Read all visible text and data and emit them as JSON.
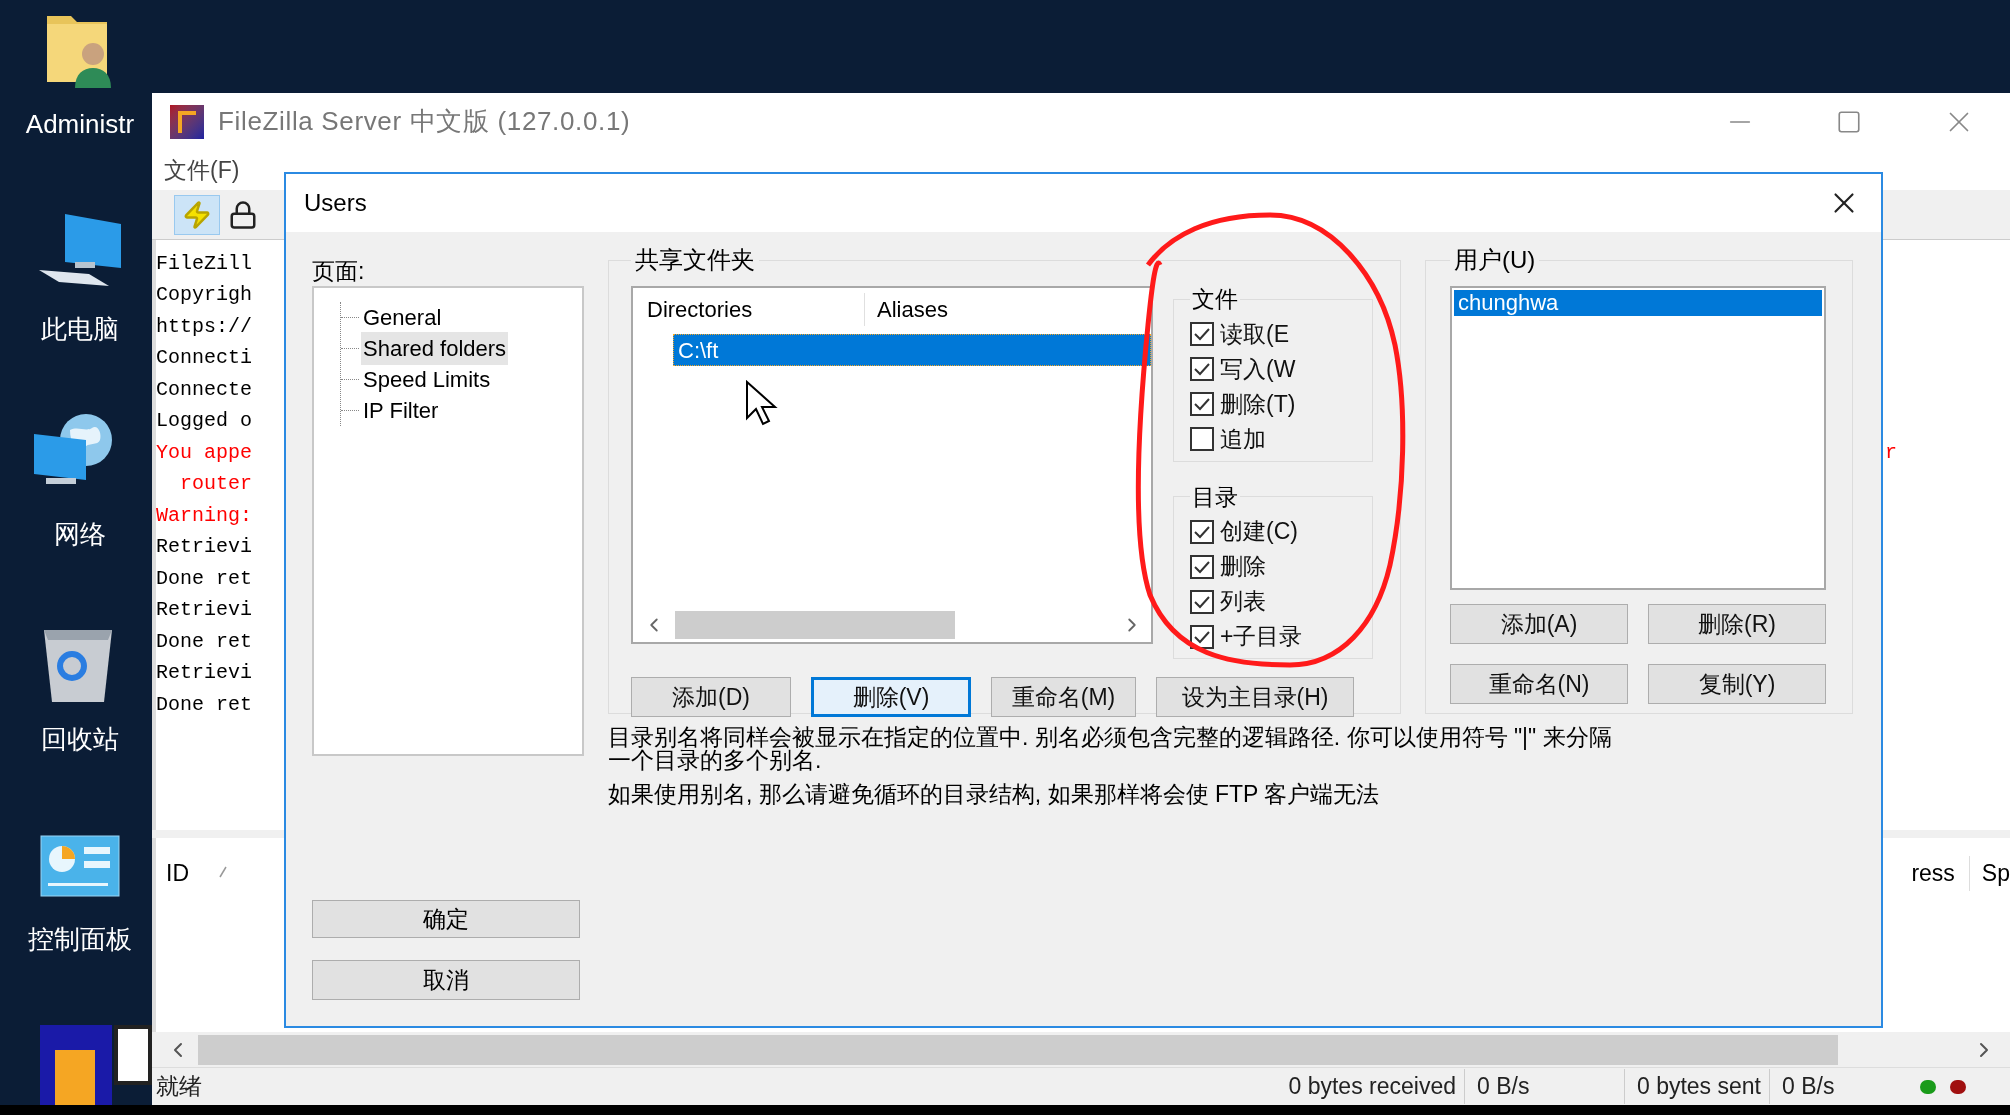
{
  "desktop": {
    "icons": [
      {
        "label": "Administr",
        "kind": "user-folder"
      },
      {
        "label": "此电脑",
        "kind": "computer"
      },
      {
        "label": "网络",
        "kind": "network"
      },
      {
        "label": "回收站",
        "kind": "recycle"
      },
      {
        "label": "控制面板",
        "kind": "control"
      }
    ]
  },
  "window": {
    "title": "FileZilla Server 中文版 (127.0.0.1)",
    "menu": [
      "文件(F)"
    ],
    "log": [
      {
        "text": "FileZill",
        "kind": "normal"
      },
      {
        "text": "Copyrigh",
        "kind": "normal"
      },
      {
        "text": "https://",
        "kind": "normal"
      },
      {
        "text": "Connecti",
        "kind": "normal"
      },
      {
        "text": "Connecte",
        "kind": "normal"
      },
      {
        "text": "Logged o",
        "kind": "normal"
      },
      {
        "text": "You appe",
        "kind": "error",
        "tail": "r"
      },
      {
        "text": "  router",
        "kind": "error"
      },
      {
        "text": "Warning:",
        "kind": "error"
      },
      {
        "text": "Retrievi",
        "kind": "normal"
      },
      {
        "text": "Done ret",
        "kind": "normal"
      },
      {
        "text": "Retrievi",
        "kind": "normal"
      },
      {
        "text": "Done ret",
        "kind": "normal"
      },
      {
        "text": "Retrievi",
        "kind": "normal"
      },
      {
        "text": "Done ret",
        "kind": "normal"
      }
    ],
    "list_columns": [
      "ID",
      "ress",
      "Sp"
    ],
    "status_bar": {
      "state": "就绪",
      "received": "0 bytes received",
      "received_rate": "0 B/s",
      "sent": "0 bytes sent",
      "sent_rate": "0 B/s"
    }
  },
  "dialog": {
    "title": "Users",
    "pages_label": "页面:",
    "pages": [
      {
        "label": "General",
        "selected": false
      },
      {
        "label": "Shared folders",
        "selected": true
      },
      {
        "label": "Speed Limits",
        "selected": false
      },
      {
        "label": "IP Filter",
        "selected": false
      }
    ],
    "ok": "确定",
    "cancel": "取消",
    "shared": {
      "title": "共享文件夹",
      "columns": [
        "Directories",
        "Aliases"
      ],
      "rows": [
        {
          "directory": "C:\\ft",
          "selected": true
        }
      ],
      "buttons": [
        {
          "label": "添加(D)",
          "focused": false
        },
        {
          "label": "删除(V)",
          "focused": true
        },
        {
          "label": "重命名(M)",
          "focused": false
        },
        {
          "label": "设为主目录(H)",
          "focused": false
        }
      ]
    },
    "files": {
      "title": "文件",
      "options": [
        {
          "label": "读取(E",
          "checked": true
        },
        {
          "label": "写入(W",
          "checked": true
        },
        {
          "label": "删除(T)",
          "checked": true
        },
        {
          "label": "追加",
          "checked": false
        }
      ]
    },
    "directories": {
      "title": "目录",
      "options": [
        {
          "label": "创建(C)",
          "checked": true
        },
        {
          "label": "删除",
          "checked": true
        },
        {
          "label": "列表",
          "checked": true
        },
        {
          "label": "+子目录",
          "checked": true
        }
      ]
    },
    "users": {
      "title": "用户(U)",
      "items": [
        {
          "name": "chunghwa",
          "selected": true
        }
      ],
      "buttons": [
        "添加(A)",
        "删除(R)",
        "重命名(N)",
        "复制(Y)"
      ]
    },
    "help": [
      "目录别名将同样会被显示在指定的位置中. 别名必须包含完整的逻辑路径. 你可以使用符号 \"|\" 来分隔一个目录的多个别名.",
      "如果使用别名, 那么请避免循环的目录结构, 如果那样将会使 FTP 客户端无法"
    ]
  }
}
